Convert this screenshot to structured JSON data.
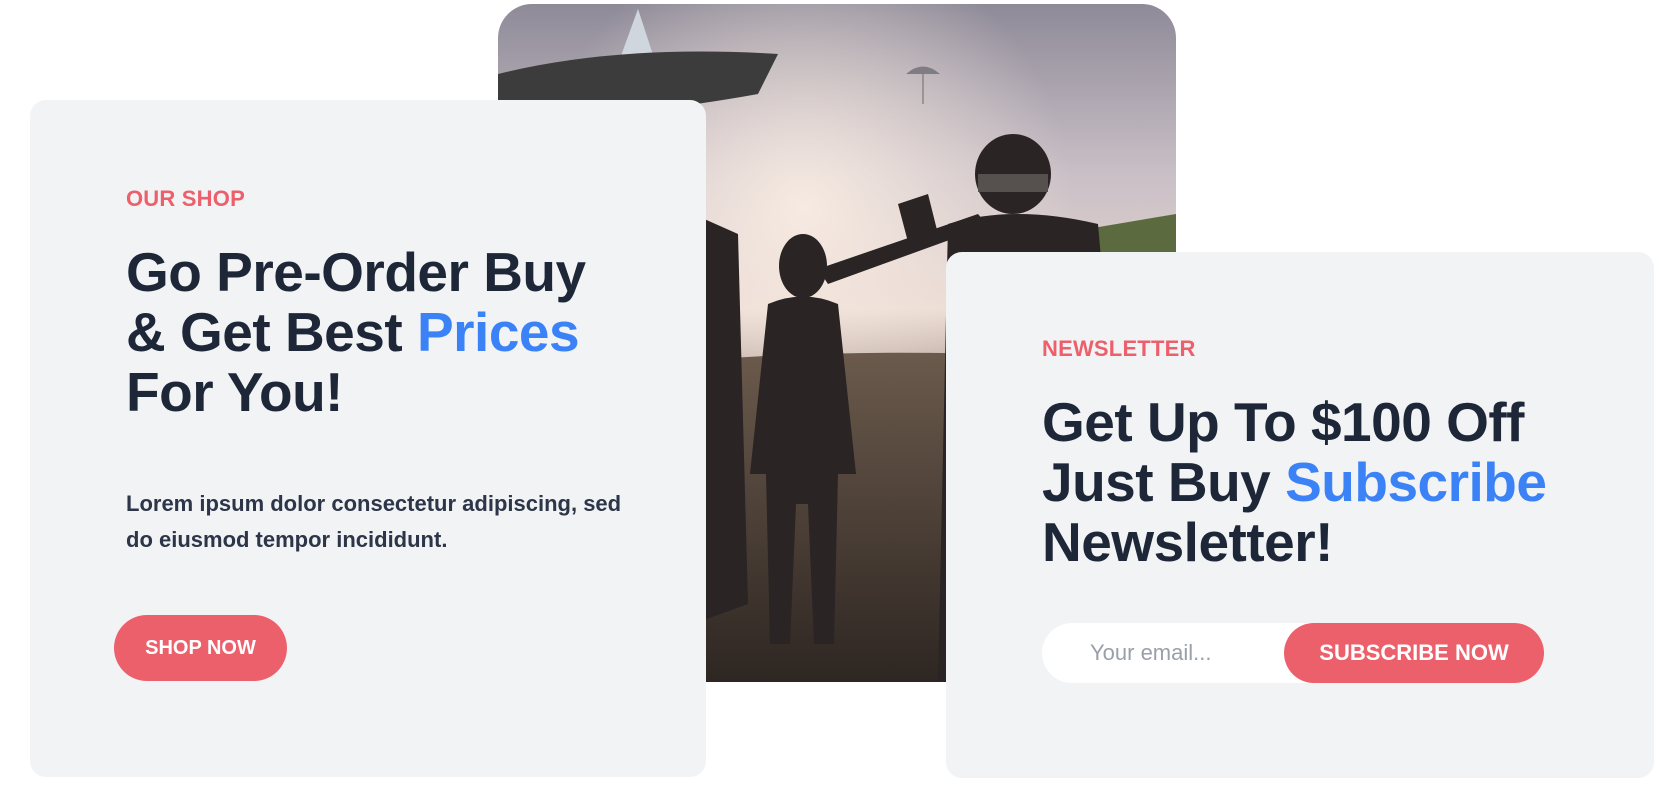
{
  "shop": {
    "eyebrow": "OUR SHOP",
    "heading_line1": "Go Pre-Order Buy",
    "heading_line2": "& Get Best ",
    "heading_accent": "Prices",
    "heading_line3": "For You!",
    "body": "Lorem ipsum dolor consectetur adipiscing, sed do eiusmod tempor incididunt.",
    "button_label": "SHOP NOW"
  },
  "newsletter": {
    "eyebrow": "NEWSLETTER",
    "heading_line1": "Get Up To $100 Off",
    "heading_line2": "Just Buy ",
    "heading_accent": "Subscribe",
    "heading_line3": "Newsletter!",
    "email_placeholder": "Your email...",
    "button_label": "SUBSCRIBE NOW"
  },
  "artwork": {
    "subject": "battle-royale-game-artwork"
  },
  "colors": {
    "accent_red": "#ec606c",
    "accent_blue": "#3b82f6",
    "heading": "#1e2738",
    "card_bg": "#f2f3f5"
  }
}
